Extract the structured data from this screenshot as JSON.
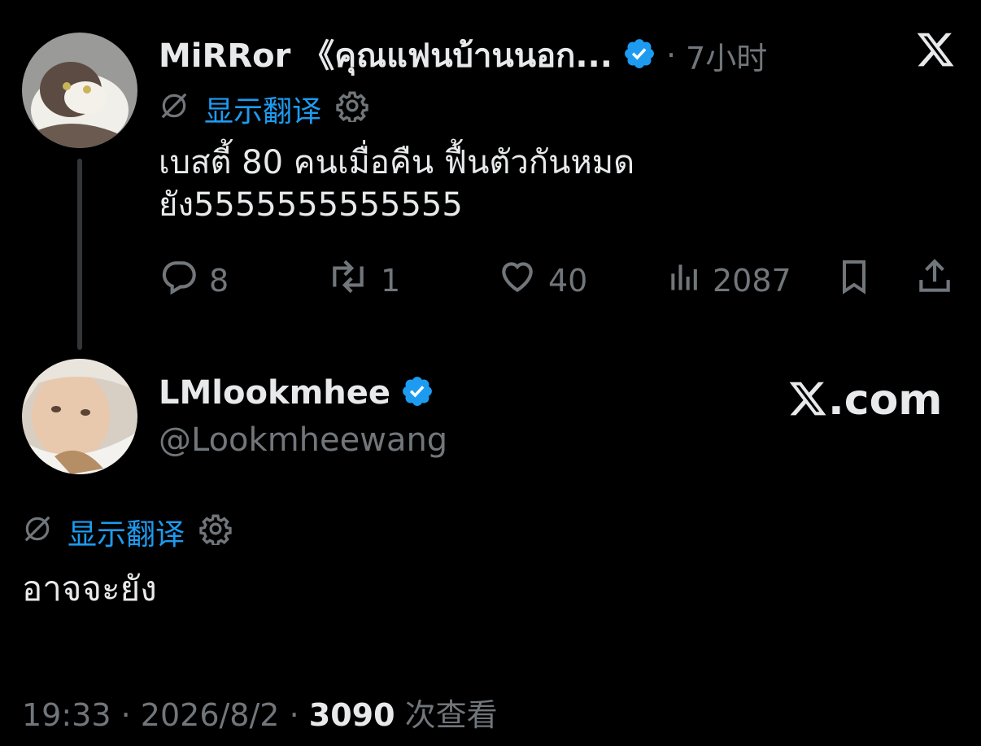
{
  "reply_to": {
    "author_name": "MiRRor 《คุณแฟนบ้านนอก...",
    "separator": "·",
    "time_ago": "7小时",
    "translate_label": "显示翻译",
    "text_line1": "เบสตี้ 80 คนเมื่อคืน ฟื้นตัวกันหมด",
    "text_line2": "ยัง5555555555555",
    "actions": {
      "replies": "8",
      "retweets": "1",
      "likes": "40",
      "views": "2087"
    }
  },
  "tweet": {
    "author_name": "LMlookmhee",
    "handle": "@Lookmheewang",
    "translate_label": "显示翻译",
    "text": "อาจจะยัง",
    "time": "19:33",
    "date": "2026/8/2",
    "views_count": "3090",
    "views_label": "次查看",
    "dot": "·"
  },
  "brand": {
    "watermark": ".com"
  },
  "colors": {
    "background": "#000000",
    "text": "#e7e9ea",
    "muted": "#71767b",
    "link": "#1d9bf0",
    "verified": "#1d9bf0"
  },
  "icons": [
    "x-logo-icon",
    "verified-badge-icon",
    "translate-off-icon",
    "gear-icon",
    "reply-icon",
    "retweet-icon",
    "like-icon",
    "views-icon",
    "bookmark-icon",
    "share-icon"
  ]
}
